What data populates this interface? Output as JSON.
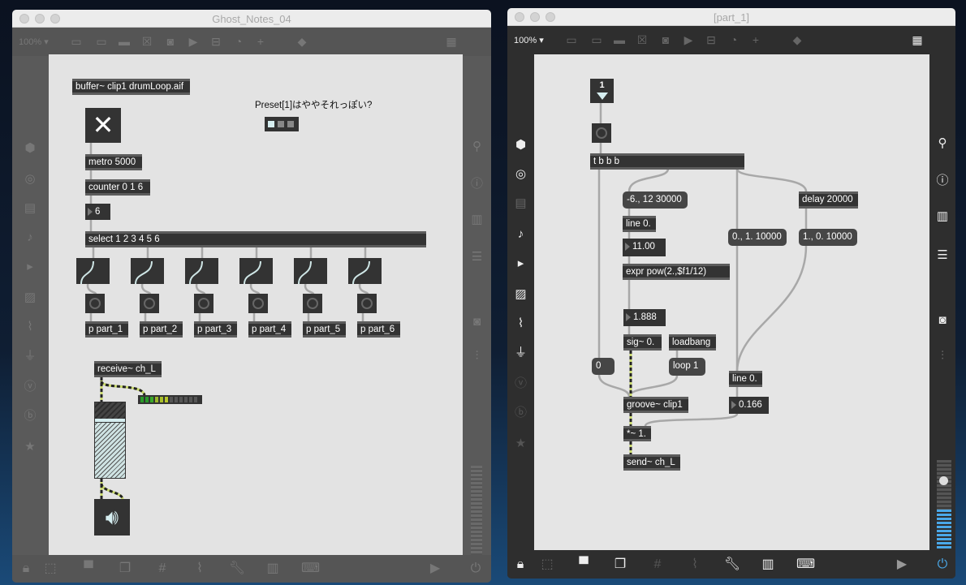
{
  "left_window": {
    "title": "Ghost_Notes_04",
    "zoom": "100% ▾",
    "objects": {
      "buffer": "buffer~ clip1 drumLoop.aif",
      "comment": "Preset[1]はややそれっぽい?",
      "metro": "metro 5000",
      "counter": "counter 0 1 6",
      "number": "6",
      "select": "select 1 2 3 4 5 6",
      "receive": "receive~ ch_L"
    },
    "subpatchers": [
      "p part_1",
      "p part_2",
      "p part_3",
      "p part_4",
      "p part_5",
      "p part_6"
    ],
    "meter_level": 0.5,
    "gain_level": 0.75
  },
  "right_window": {
    "title": "[part_1]",
    "zoom": "100% ▾",
    "objects": {
      "top_number": "1",
      "trigger": "t b b b",
      "msg_pitch": "-6., 12 30000",
      "line1": "line 0.",
      "num1": "11.00",
      "expr": "expr pow(2.,$f1/12)",
      "num2": "1.888",
      "sig": "sig~ 0.",
      "loadbang": "loadbang",
      "msg_zero": "0",
      "msg_loop": "loop 1",
      "groove": "groove~ clip1",
      "mult": "*~ 1.",
      "send": "send~ ch_L",
      "msg_fadein": "0., 1. 10000",
      "delay": "delay 20000",
      "msg_fadeout": "1., 0. 10000",
      "line2": "line 0.",
      "num3": "0.166"
    },
    "volume_level": 0.85,
    "meter_level": 0.45
  },
  "colors": {
    "accent": "#4aa8e8",
    "signal_cord": "#c8d86a",
    "control_cord": "#a8a8a8"
  }
}
